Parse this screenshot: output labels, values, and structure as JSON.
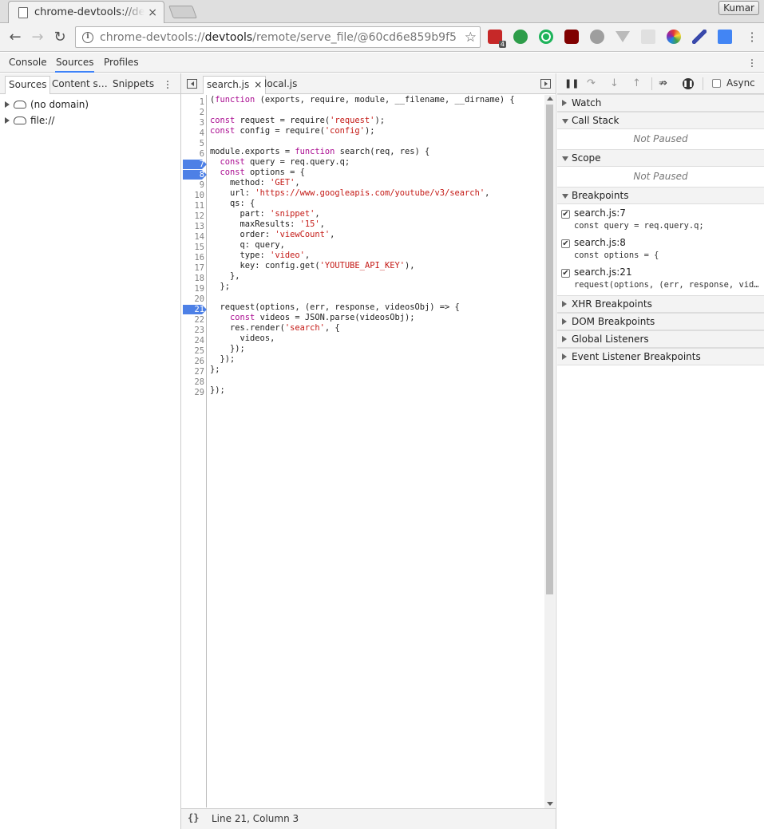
{
  "browser": {
    "tab_title": "chrome-devtools://devtools/remote/serve_file",
    "tab_close": "×",
    "profile_name": "Kumar",
    "url_scheme": "chrome-devtools://",
    "url_host": "devtools",
    "url_path": "/remote/serve_file/@60cd6e859b9f5",
    "badge_count": "4"
  },
  "devtools": {
    "tabs": [
      "Console",
      "Sources",
      "Profiles"
    ],
    "active_tab": "Sources"
  },
  "navigator": {
    "tabs": [
      "Sources",
      "Content s…",
      "Snippets"
    ],
    "tree": [
      "(no domain)",
      "file://"
    ]
  },
  "editor": {
    "tabs": [
      "search.js",
      "local.js"
    ],
    "tab_close": "×",
    "breakpoint_lines": [
      7,
      8,
      21
    ],
    "status": "Line 21, Column 3",
    "format_label": "{}"
  },
  "code_lines": [
    "(function (exports, require, module, __filename, __dirname) {",
    "",
    "const request = require('request');",
    "const config = require('config');",
    "",
    "module.exports = function search(req, res) {",
    "  const query = req.query.q;",
    "  const options = {",
    "    method: 'GET',",
    "    url: 'https://www.googleapis.com/youtube/v3/search',",
    "    qs: {",
    "      part: 'snippet',",
    "      maxResults: '15',",
    "      order: 'viewCount',",
    "      q: query,",
    "      type: 'video',",
    "      key: config.get('YOUTUBE_API_KEY'),",
    "    },",
    "  };",
    "",
    "  request(options, (err, response, videosObj) => {",
    "    const videos = JSON.parse(videosObj);",
    "    res.render('search', {",
    "      videos,",
    "    });",
    "  });",
    "};",
    "",
    "});"
  ],
  "debugger": {
    "async_label": "Async",
    "sections": {
      "watch": "Watch",
      "call_stack": "Call Stack",
      "scope": "Scope",
      "breakpoints": "Breakpoints",
      "xhr": "XHR Breakpoints",
      "dom": "DOM Breakpoints",
      "global": "Global Listeners",
      "event": "Event Listener Breakpoints"
    },
    "not_paused": "Not Paused",
    "breakpoints": [
      {
        "name": "search.js:7",
        "code": "const query = req.query.q;"
      },
      {
        "name": "search.js:8",
        "code": "const options = {"
      },
      {
        "name": "search.js:21",
        "code": "request(options, (err, response, videosObj) => {"
      }
    ]
  },
  "colors": {
    "accent": "#3e82f7",
    "breakpoint": "#4d80e6",
    "keyword": "#aa0d91",
    "string": "#c41a16"
  }
}
